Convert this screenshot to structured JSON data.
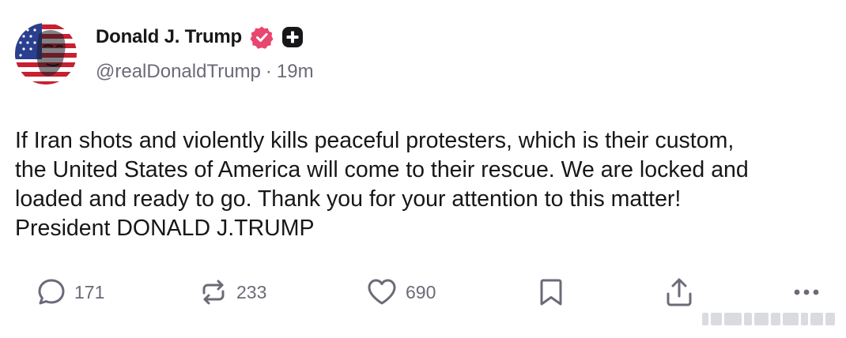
{
  "post": {
    "author": {
      "display_name": "Donald J. Trump",
      "handle": "@realDonaldTrump",
      "separator": "·",
      "time_ago": "19m",
      "verified_icon": "verified-badge-icon",
      "badge_icon": "plus-badge-icon"
    },
    "text_lines": [
      "If Iran shots and violently kills peaceful protesters, which is their custom,",
      "the United States of America will come to their rescue. We are locked and",
      "loaded and ready to go. Thank you for your attention to this matter!",
      "President DONALD J.TRUMP"
    ],
    "actions": {
      "replies": "171",
      "reposts": "233",
      "likes": "690",
      "reply_icon": "comment-icon",
      "repost_icon": "repost-icon",
      "like_icon": "heart-icon",
      "bookmark_icon": "bookmark-icon",
      "share_icon": "share-icon",
      "more_icon": "more-dots-icon"
    }
  },
  "colors": {
    "text_primary": "#17171a",
    "text_secondary": "#6b6b78",
    "verified": "#e8466f"
  }
}
